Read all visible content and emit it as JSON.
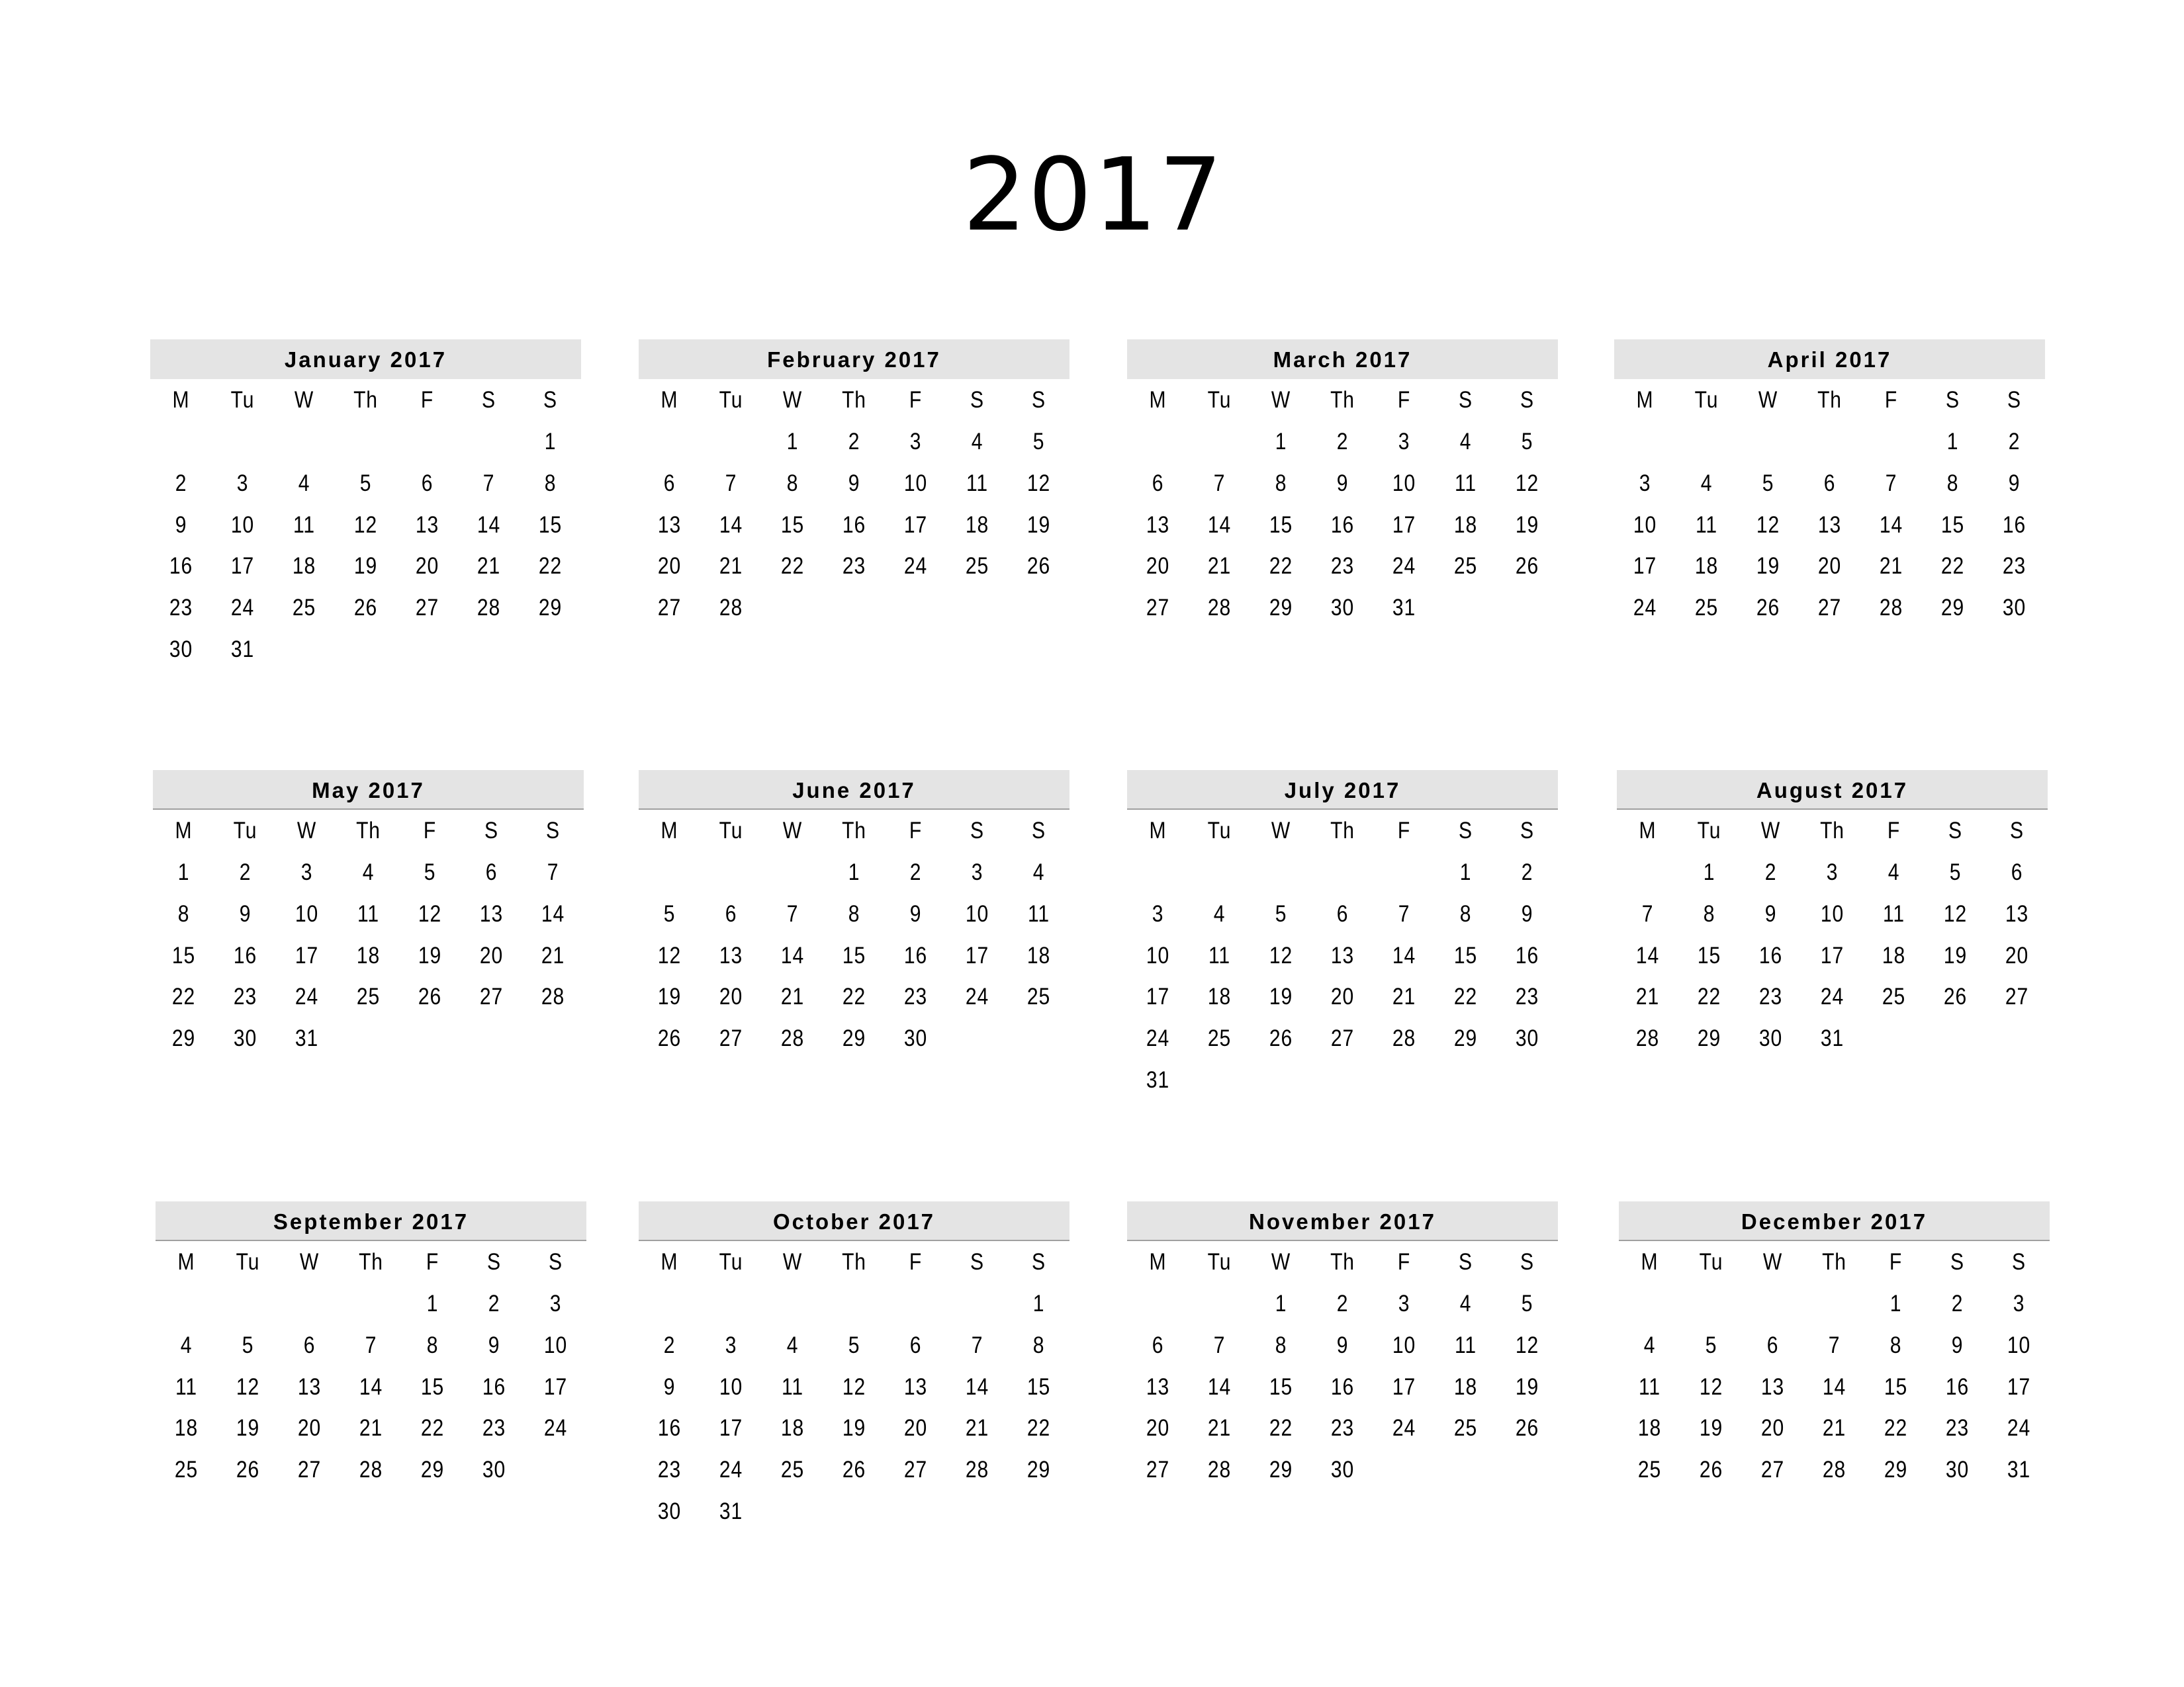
{
  "title": "2017",
  "weekday_labels": [
    "M",
    "Tu",
    "W",
    "Th",
    "F",
    "S",
    "S"
  ],
  "months": [
    {
      "name": "January 2017",
      "weeks": [
        [
          "",
          "",
          "",
          "",
          "",
          "",
          "1"
        ],
        [
          "2",
          "3",
          "4",
          "5",
          "6",
          "7",
          "8"
        ],
        [
          "9",
          "10",
          "11",
          "12",
          "13",
          "14",
          "15"
        ],
        [
          "16",
          "17",
          "18",
          "19",
          "20",
          "21",
          "22"
        ],
        [
          "23",
          "24",
          "25",
          "26",
          "27",
          "28",
          "29"
        ],
        [
          "30",
          "31",
          "",
          "",
          "",
          "",
          ""
        ]
      ]
    },
    {
      "name": "February 2017",
      "weeks": [
        [
          "",
          "",
          "1",
          "2",
          "3",
          "4",
          "5"
        ],
        [
          "6",
          "7",
          "8",
          "9",
          "10",
          "11",
          "12"
        ],
        [
          "13",
          "14",
          "15",
          "16",
          "17",
          "18",
          "19"
        ],
        [
          "20",
          "21",
          "22",
          "23",
          "24",
          "25",
          "26"
        ],
        [
          "27",
          "28",
          "",
          "",
          "",
          "",
          ""
        ]
      ]
    },
    {
      "name": "March 2017",
      "weeks": [
        [
          "",
          "",
          "1",
          "2",
          "3",
          "4",
          "5"
        ],
        [
          "6",
          "7",
          "8",
          "9",
          "10",
          "11",
          "12"
        ],
        [
          "13",
          "14",
          "15",
          "16",
          "17",
          "18",
          "19"
        ],
        [
          "20",
          "21",
          "22",
          "23",
          "24",
          "25",
          "26"
        ],
        [
          "27",
          "28",
          "29",
          "30",
          "31",
          "",
          ""
        ]
      ]
    },
    {
      "name": "April 2017",
      "weeks": [
        [
          "",
          "",
          "",
          "",
          "",
          "1",
          "2"
        ],
        [
          "3",
          "4",
          "5",
          "6",
          "7",
          "8",
          "9"
        ],
        [
          "10",
          "11",
          "12",
          "13",
          "14",
          "15",
          "16"
        ],
        [
          "17",
          "18",
          "19",
          "20",
          "21",
          "22",
          "23"
        ],
        [
          "24",
          "25",
          "26",
          "27",
          "28",
          "29",
          "30"
        ]
      ]
    },
    {
      "name": "May 2017",
      "weeks": [
        [
          "1",
          "2",
          "3",
          "4",
          "5",
          "6",
          "7"
        ],
        [
          "8",
          "9",
          "10",
          "11",
          "12",
          "13",
          "14"
        ],
        [
          "15",
          "16",
          "17",
          "18",
          "19",
          "20",
          "21"
        ],
        [
          "22",
          "23",
          "24",
          "25",
          "26",
          "27",
          "28"
        ],
        [
          "29",
          "30",
          "31",
          "",
          "",
          "",
          ""
        ]
      ]
    },
    {
      "name": "June 2017",
      "weeks": [
        [
          "",
          "",
          "",
          "1",
          "2",
          "3",
          "4"
        ],
        [
          "5",
          "6",
          "7",
          "8",
          "9",
          "10",
          "11"
        ],
        [
          "12",
          "13",
          "14",
          "15",
          "16",
          "17",
          "18"
        ],
        [
          "19",
          "20",
          "21",
          "22",
          "23",
          "24",
          "25"
        ],
        [
          "26",
          "27",
          "28",
          "29",
          "30",
          "",
          ""
        ]
      ]
    },
    {
      "name": "July 2017",
      "weeks": [
        [
          "",
          "",
          "",
          "",
          "",
          "1",
          "2"
        ],
        [
          "3",
          "4",
          "5",
          "6",
          "7",
          "8",
          "9"
        ],
        [
          "10",
          "11",
          "12",
          "13",
          "14",
          "15",
          "16"
        ],
        [
          "17",
          "18",
          "19",
          "20",
          "21",
          "22",
          "23"
        ],
        [
          "24",
          "25",
          "26",
          "27",
          "28",
          "29",
          "30"
        ],
        [
          "31",
          "",
          "",
          "",
          "",
          "",
          ""
        ]
      ]
    },
    {
      "name": "August 2017",
      "weeks": [
        [
          "",
          "1",
          "2",
          "3",
          "4",
          "5",
          "6"
        ],
        [
          "7",
          "8",
          "9",
          "10",
          "11",
          "12",
          "13"
        ],
        [
          "14",
          "15",
          "16",
          "17",
          "18",
          "19",
          "20"
        ],
        [
          "21",
          "22",
          "23",
          "24",
          "25",
          "26",
          "27"
        ],
        [
          "28",
          "29",
          "30",
          "31",
          "",
          "",
          ""
        ]
      ]
    },
    {
      "name": "September 2017",
      "weeks": [
        [
          "",
          "",
          "",
          "",
          "1",
          "2",
          "3"
        ],
        [
          "4",
          "5",
          "6",
          "7",
          "8",
          "9",
          "10"
        ],
        [
          "11",
          "12",
          "13",
          "14",
          "15",
          "16",
          "17"
        ],
        [
          "18",
          "19",
          "20",
          "21",
          "22",
          "23",
          "24"
        ],
        [
          "25",
          "26",
          "27",
          "28",
          "29",
          "30",
          ""
        ]
      ]
    },
    {
      "name": "October 2017",
      "weeks": [
        [
          "",
          "",
          "",
          "",
          "",
          "",
          "1"
        ],
        [
          "2",
          "3",
          "4",
          "5",
          "6",
          "7",
          "8"
        ],
        [
          "9",
          "10",
          "11",
          "12",
          "13",
          "14",
          "15"
        ],
        [
          "16",
          "17",
          "18",
          "19",
          "20",
          "21",
          "22"
        ],
        [
          "23",
          "24",
          "25",
          "26",
          "27",
          "28",
          "29"
        ],
        [
          "30",
          "31",
          "",
          "",
          "",
          "",
          ""
        ]
      ]
    },
    {
      "name": "November 2017",
      "weeks": [
        [
          "",
          "",
          "1",
          "2",
          "3",
          "4",
          "5"
        ],
        [
          "6",
          "7",
          "8",
          "9",
          "10",
          "11",
          "12"
        ],
        [
          "13",
          "14",
          "15",
          "16",
          "17",
          "18",
          "19"
        ],
        [
          "20",
          "21",
          "22",
          "23",
          "24",
          "25",
          "26"
        ],
        [
          "27",
          "28",
          "29",
          "30",
          "",
          "",
          ""
        ]
      ]
    },
    {
      "name": "December 2017",
      "weeks": [
        [
          "",
          "",
          "",
          "",
          "1",
          "2",
          "3"
        ],
        [
          "4",
          "5",
          "6",
          "7",
          "8",
          "9",
          "10"
        ],
        [
          "11",
          "12",
          "13",
          "14",
          "15",
          "16",
          "17"
        ],
        [
          "18",
          "19",
          "20",
          "21",
          "22",
          "23",
          "24"
        ],
        [
          "25",
          "26",
          "27",
          "28",
          "29",
          "30",
          "31"
        ]
      ]
    }
  ]
}
